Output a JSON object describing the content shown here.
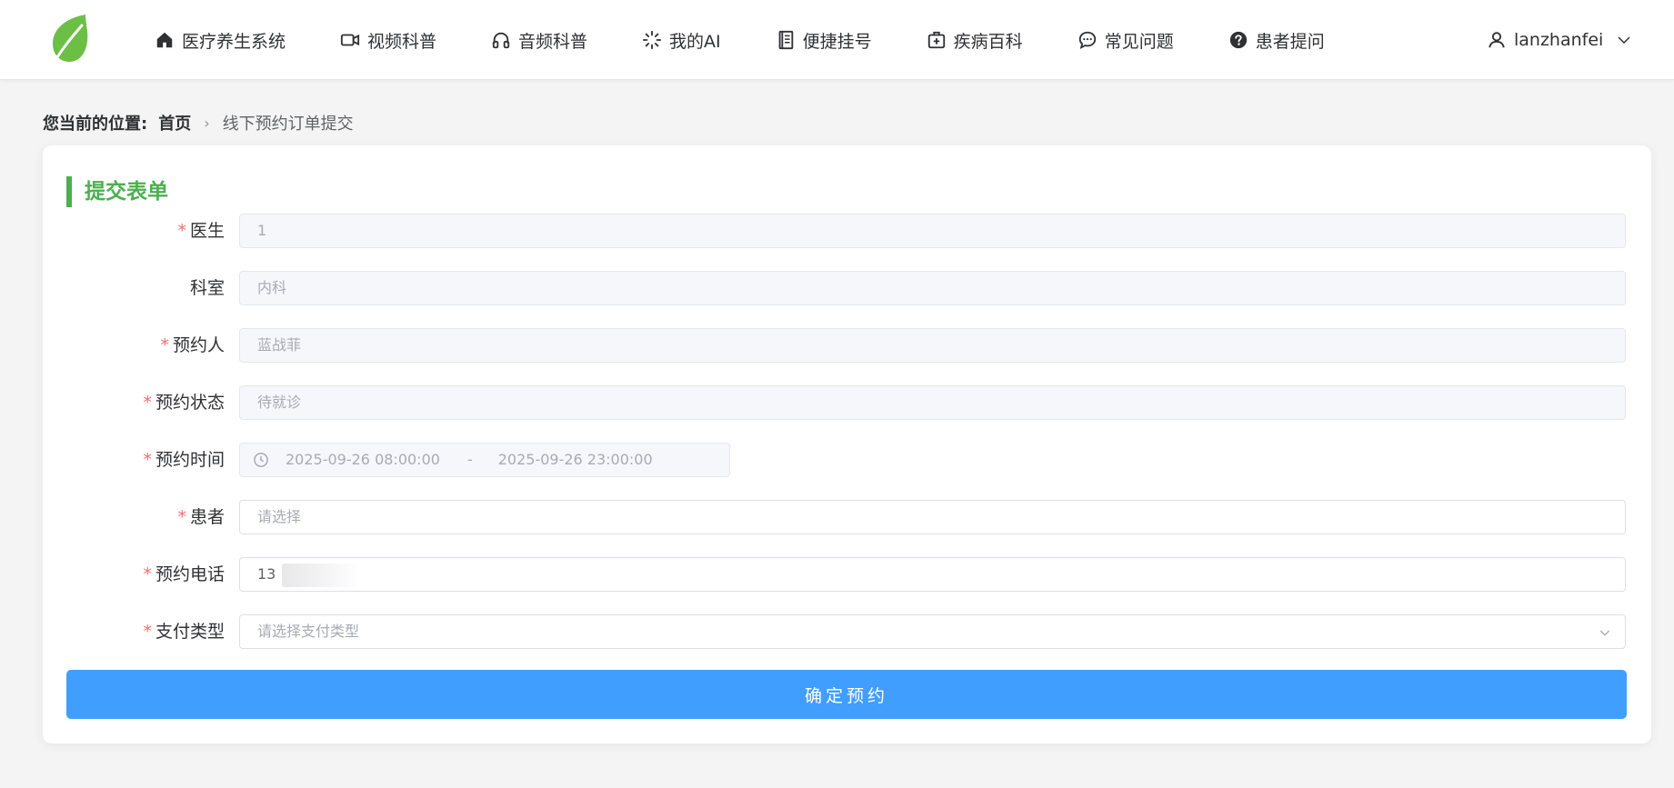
{
  "header": {
    "nav": [
      {
        "label": "医疗养生系统",
        "icon": "home-icon"
      },
      {
        "label": "视频科普",
        "icon": "video-camera-icon"
      },
      {
        "label": "音频科普",
        "icon": "headphones-icon"
      },
      {
        "label": "我的AI",
        "icon": "loading-spinner-icon"
      },
      {
        "label": "便捷挂号",
        "icon": "notebook-icon"
      },
      {
        "label": "疾病百科",
        "icon": "first-aid-kit-icon"
      },
      {
        "label": "常见问题",
        "icon": "chat-bubble-icon"
      },
      {
        "label": "患者提问",
        "icon": "question-circle-icon"
      }
    ],
    "user": {
      "name": "lanzhanfei",
      "icon": "user-icon"
    }
  },
  "breadcrumb": {
    "label": "您当前的位置:",
    "home": "首页",
    "current": "线下预约订单提交"
  },
  "form": {
    "title": "提交表单",
    "fields": [
      {
        "label": "医生",
        "required": true,
        "value": "1",
        "disabled": true
      },
      {
        "label": "科室",
        "required": false,
        "value": "内科",
        "disabled": true
      },
      {
        "label": "预约人",
        "required": true,
        "value": "蓝战菲",
        "disabled": true
      },
      {
        "label": "预约状态",
        "required": true,
        "value": "待就诊",
        "disabled": true
      },
      {
        "label": "预约时间",
        "required": true,
        "start": "2025-09-26 08:00:00",
        "separator": "-",
        "end": "2025-09-26 23:00:00",
        "disabled": true
      },
      {
        "label": "患者",
        "required": true,
        "placeholder": "请选择"
      },
      {
        "label": "预约电话",
        "required": true,
        "value": "13"
      },
      {
        "label": "支付类型",
        "required": true,
        "placeholder": "请选择支付类型"
      }
    ],
    "submit_label": "确定预约"
  },
  "colors": {
    "accent": "#4caf50",
    "primary_button": "#409eff",
    "required": "#f56c6c",
    "logo": "#6cbf45"
  }
}
